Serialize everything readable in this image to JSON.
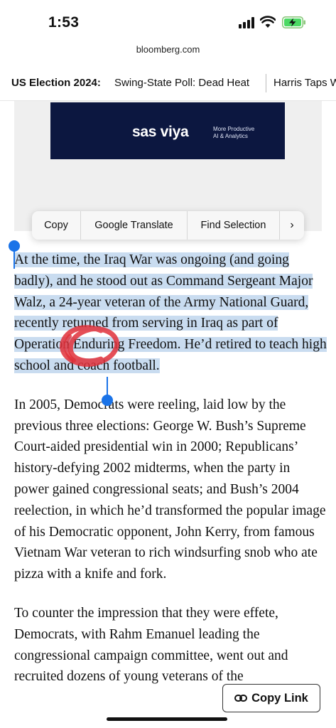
{
  "status_bar": {
    "time": "1:53"
  },
  "browser": {
    "url": "bloomberg.com"
  },
  "headline_strip": {
    "label": "US Election 2024:",
    "items": [
      "Swing-State Poll: Dead Heat",
      "Harris Taps W"
    ]
  },
  "ad": {
    "brand": "sas viya",
    "tagline_line1": "More Productive",
    "tagline_line2": "AI & Analytics"
  },
  "context_menu": {
    "items": [
      "Copy",
      "Google Translate",
      "Find Selection"
    ],
    "more": "›"
  },
  "article": {
    "paragraphs": [
      "At the time, the Iraq War was ongoing (and going badly), and he stood out as Command Sergeant Major Walz, a 24-year veteran of the Army National Guard, recently returned from serving in Iraq as part of Operation Enduring Freedom. He’d retired to teach high school and coach football.",
      "In 2005, Democrats were reeling, laid low by the previous three elections: George W. Bush’s Supreme Court-aided presidential win in 2000; Republicans’ history-defying 2002 midterms, when the party in power gained congressional seats; and Bush’s 2004 reelection, in which he’d transformed the popular image of his Democratic opponent, John Kerry, from famous Vietnam War veteran to rich windsurfing snob who ate pizza with a knife and fork.",
      "To counter the impression that they were effete, Democrats, with Rahm Emanuel leading the congressional campaign committee, went out and recruited dozens of young veterans of the"
    ]
  },
  "copy_link": {
    "label": "Copy Link"
  },
  "colors": {
    "selection": "#c9dcf0",
    "handle": "#1a73e8",
    "scribble": "#e0303a",
    "ad_bg": "#0c1740"
  }
}
